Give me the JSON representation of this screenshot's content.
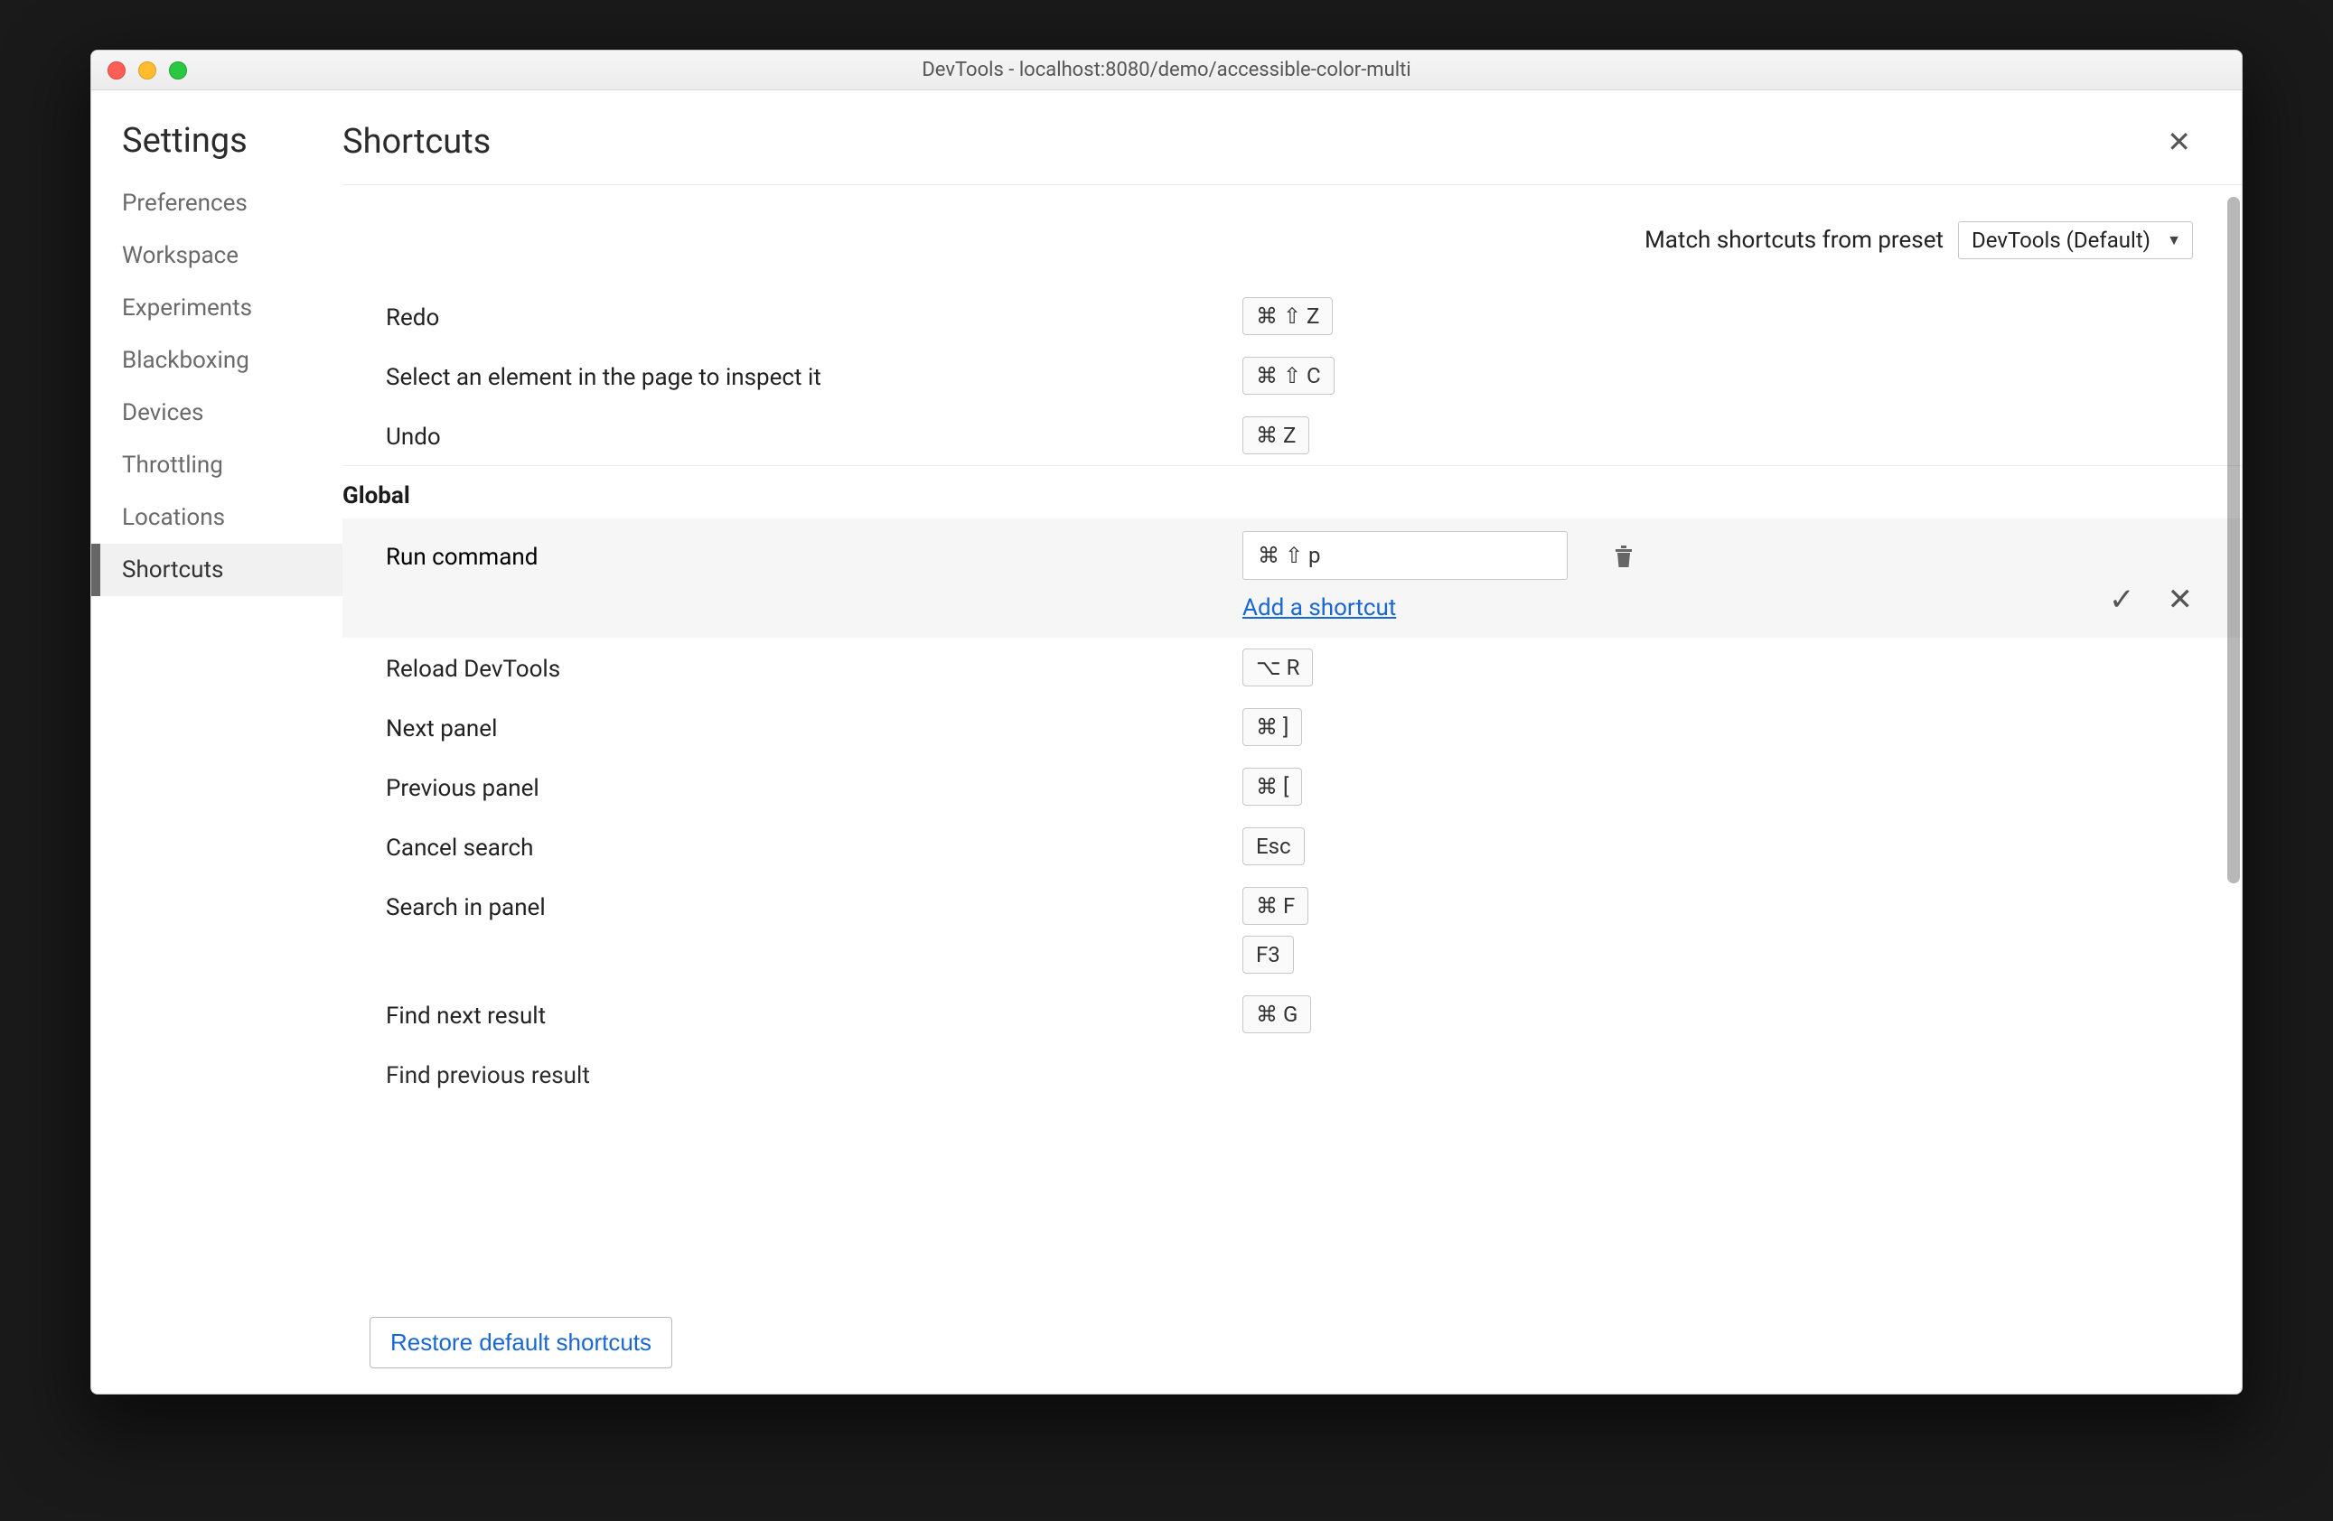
{
  "window": {
    "title": "DevTools - localhost:8080/demo/accessible-color-multi"
  },
  "sidebar": {
    "title": "Settings",
    "items": [
      {
        "label": "Preferences"
      },
      {
        "label": "Workspace"
      },
      {
        "label": "Experiments"
      },
      {
        "label": "Blackboxing"
      },
      {
        "label": "Devices"
      },
      {
        "label": "Throttling"
      },
      {
        "label": "Locations"
      },
      {
        "label": "Shortcuts",
        "active": true
      }
    ]
  },
  "page": {
    "title": "Shortcuts",
    "preset_label": "Match shortcuts from preset",
    "preset_value": "DevTools (Default)",
    "restore_button": "Restore default shortcuts",
    "add_shortcut_link": "Add a shortcut"
  },
  "top_rows": [
    {
      "label": "Redo",
      "keys": "⌘ ⇧ Z"
    },
    {
      "label": "Select an element in the page to inspect it",
      "keys": "⌘ ⇧ C"
    },
    {
      "label": "Undo",
      "keys": "⌘ Z"
    }
  ],
  "section": {
    "heading": "Global",
    "edit": {
      "label": "Run command",
      "value": "⌘ ⇧ p"
    },
    "rows": [
      {
        "label": "Reload DevTools",
        "keys": [
          "⌥ R"
        ]
      },
      {
        "label": "Next panel",
        "keys": [
          "⌘ ]"
        ]
      },
      {
        "label": "Previous panel",
        "keys": [
          "⌘ ["
        ]
      },
      {
        "label": "Cancel search",
        "keys": [
          "Esc"
        ]
      },
      {
        "label": "Search in panel",
        "keys": [
          "⌘ F",
          "F3"
        ]
      },
      {
        "label": "Find next result",
        "keys": [
          "⌘ G"
        ]
      }
    ],
    "cutoff_label": "Find previous result"
  }
}
